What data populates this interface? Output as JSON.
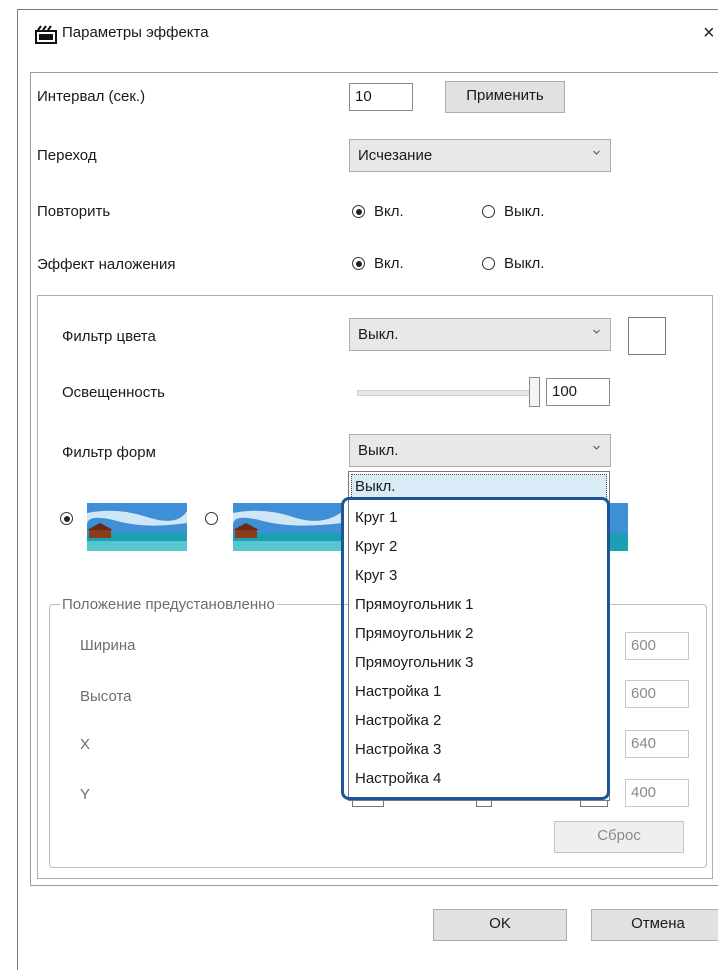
{
  "window": {
    "title": "Параметры эффекта",
    "close_label": "×"
  },
  "interval": {
    "label": "Интервал (сек.)",
    "value": "10",
    "apply_label": "Применить"
  },
  "transition": {
    "label": "Переход",
    "value": "Исчезание"
  },
  "repeat": {
    "label": "Повторить",
    "on_label": "Вкл.",
    "off_label": "Выкл.",
    "selected": "on"
  },
  "overlay": {
    "label": "Эффект наложения",
    "on_label": "Вкл.",
    "off_label": "Выкл.",
    "selected": "on"
  },
  "color_filter": {
    "label": "Фильтр цвета",
    "value": "Выкл."
  },
  "brightness": {
    "label": "Освещенность",
    "value": "100",
    "level_percent": 100
  },
  "shape_filter": {
    "label": "Фильтр форм",
    "value": "Выкл.",
    "options": [
      "Выкл.",
      "Круг 1",
      "Круг 2",
      "Круг 3",
      "Прямоугольник 1",
      "Прямоугольник 2",
      "Прямоугольник 3",
      "Настройка 1",
      "Настройка 2",
      "Настройка 3",
      "Настройка 4"
    ]
  },
  "preset": {
    "title": "Положение предустановленно",
    "width": {
      "label": "Ширина",
      "value": "600"
    },
    "height": {
      "label": "Высота",
      "value": "600"
    },
    "x": {
      "label": "X",
      "value": "640"
    },
    "y": {
      "label": "Y",
      "value": "400"
    },
    "reset_label": "Сброс"
  },
  "footer": {
    "ok_label": "OK",
    "cancel_label": "Отмена"
  },
  "colors": {
    "highlight": "#1e5598",
    "selected_item": "#d9ebf7"
  }
}
